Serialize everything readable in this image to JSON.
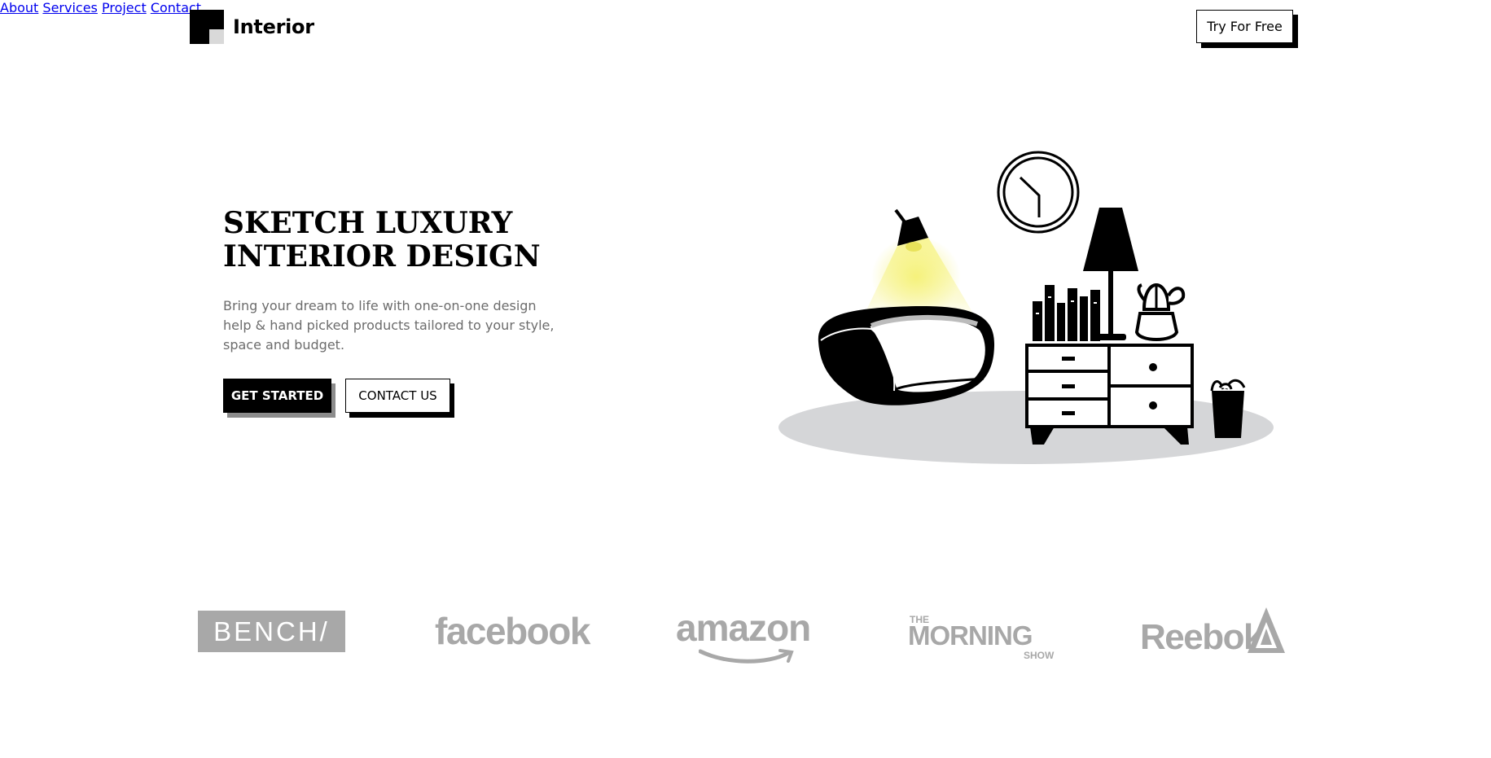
{
  "header": {
    "logo_text": "Interior",
    "nav": [
      "About",
      "Services",
      "Project",
      "Contact"
    ],
    "cta_label": "Try For Free"
  },
  "hero": {
    "title_line1": "SKETCH LUXURY",
    "title_line2": "INTERIOR DESIGN",
    "description": "Bring your dream to life with one-on-one design help & hand picked products tailored to your style, space and budget.",
    "primary_button": "GET STARTED",
    "secondary_button": "CONTACT US"
  },
  "brands": {
    "bench": "BENCH/",
    "facebook": "facebook",
    "amazon": "amazon",
    "morning_the": "THE",
    "morning_main": "MORNING",
    "morning_show": "SHOW",
    "reebok": "Reebok"
  },
  "colors": {
    "accent_black": "#000000",
    "logo_gray": "#d9d9d9",
    "brand_gray": "#a8a8a8",
    "lamp_light": "#f6f27a",
    "floor_gray": "#d5d6d8"
  },
  "icons": [
    "logo-mark-icon",
    "clock-icon",
    "desk-lamp-icon",
    "table-lamp-icon",
    "cactus-icon",
    "amazon-smile-icon",
    "reebok-delta-icon"
  ]
}
